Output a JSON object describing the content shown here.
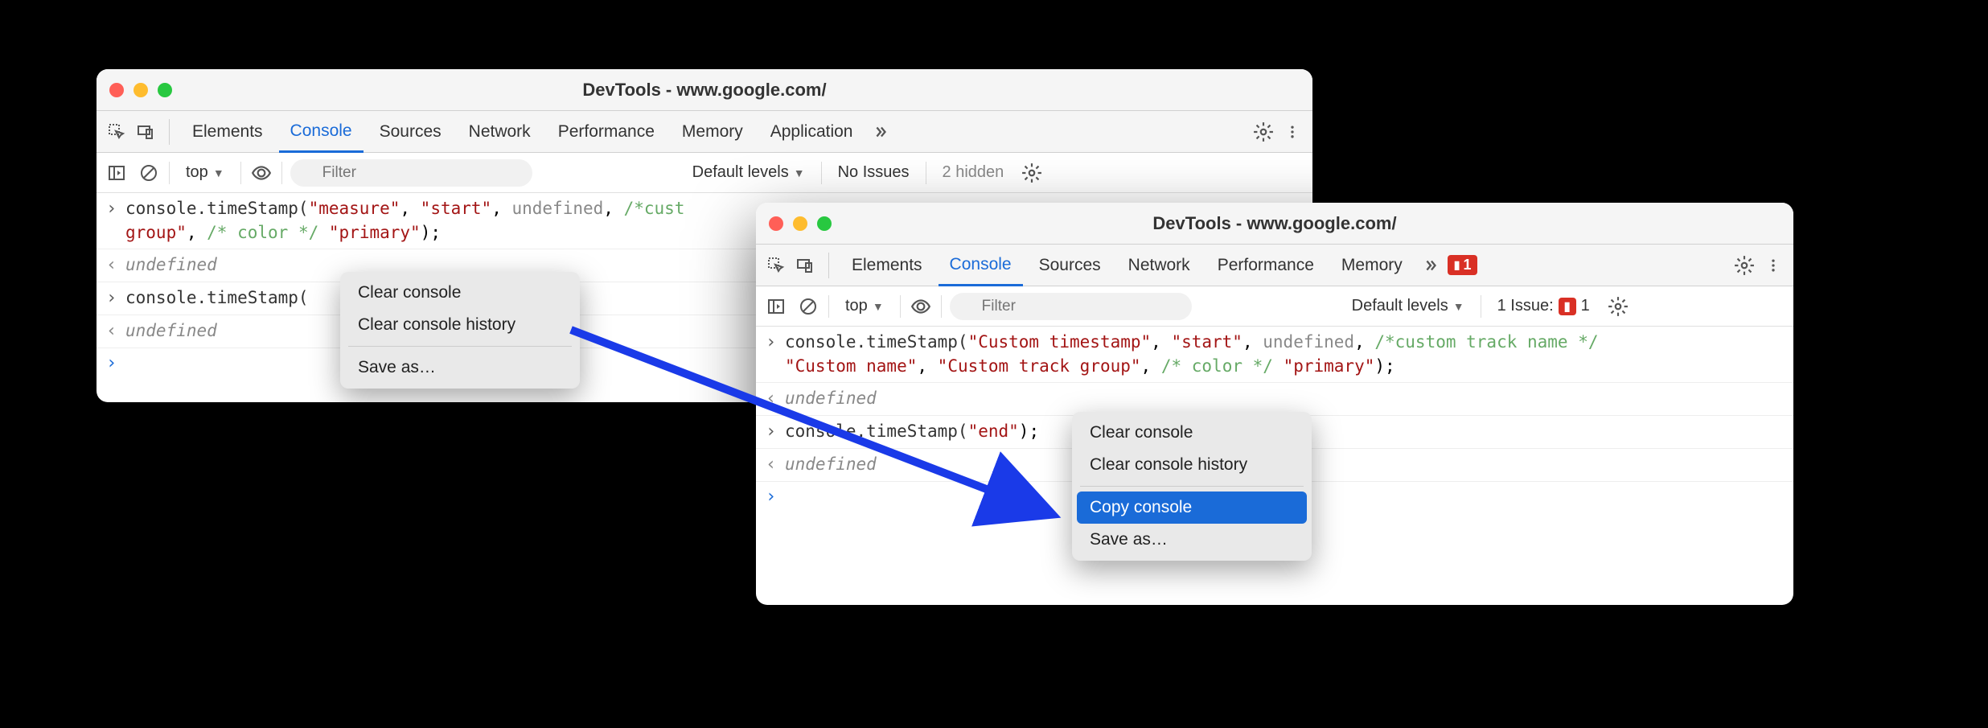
{
  "w1": {
    "title": "DevTools - www.google.com/",
    "tabs": [
      "Elements",
      "Console",
      "Sources",
      "Network",
      "Performance",
      "Memory",
      "Application"
    ],
    "activeTab": "Console",
    "top": "top",
    "filterPh": "Filter",
    "levels": "Default levels",
    "issues": "No Issues",
    "hidden": "2 hidden",
    "line1": {
      "prefix": "console.timeStamp(",
      "a1": "\"measure\"",
      "c": ", ",
      "a2": "\"start\"",
      "c2": ", ",
      "a3": "undefined",
      "c3": ", ",
      "cm1": "/*cust",
      "cont": "group\"",
      "c4": ", ",
      "cm2": "/* color */",
      "c5": " ",
      "a4": "\"primary\"",
      "end": ");"
    },
    "undef": "undefined",
    "line2": "console.timeStamp(",
    "menu": {
      "clear": "Clear console",
      "clearh": "Clear console history",
      "save": "Save as…"
    }
  },
  "w2": {
    "title": "DevTools - www.google.com/",
    "tabs": [
      "Elements",
      "Console",
      "Sources",
      "Network",
      "Performance",
      "Memory"
    ],
    "activeTab": "Console",
    "badge1": "1",
    "top": "top",
    "filterPh": "Filter",
    "levels": "Default levels",
    "issueTxt": "1 Issue:",
    "issueN": "1",
    "line1": {
      "prefix": "console.timeStamp(",
      "a1": "\"Custom timestamp\"",
      "c": ", ",
      "a2": "\"start\"",
      "c2": ", ",
      "a3": "undefined",
      "c3": ", ",
      "cm1": "/*custom track name */",
      "cont": "\"Custom name\"",
      "c4": ", ",
      "a4": "\"Custom track group\"",
      "c5": ", ",
      "cm2": "/* color */",
      "c6": " ",
      "a5": "\"primary\"",
      "end": ");"
    },
    "undef": "undefined",
    "line2": {
      "prefix": "console.timeStamp(",
      "a1": "\"end\"",
      "end": ");"
    },
    "menu": {
      "clear": "Clear console",
      "clearh": "Clear console history",
      "copy": "Copy console",
      "save": "Save as…"
    }
  }
}
